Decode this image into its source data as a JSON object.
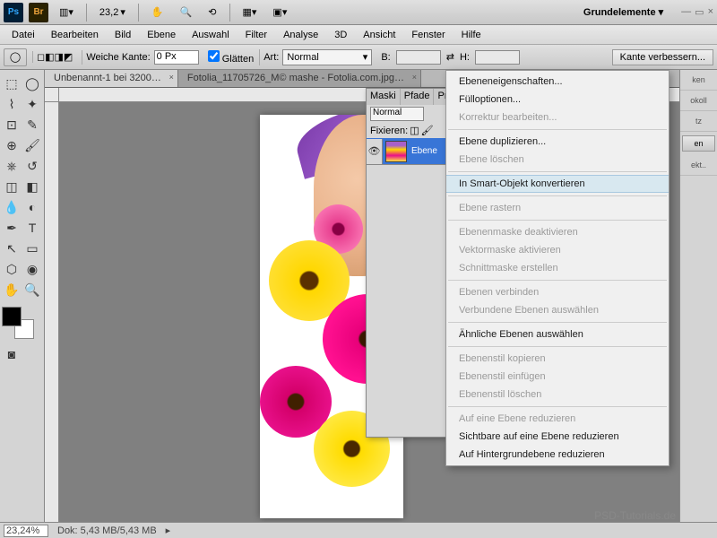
{
  "topbar": {
    "zoom_value": "23,2",
    "workspace": "Grundelemente"
  },
  "menu": [
    "Datei",
    "Bearbeiten",
    "Bild",
    "Ebene",
    "Auswahl",
    "Filter",
    "Analyse",
    "3D",
    "Ansicht",
    "Fenster",
    "Hilfe"
  ],
  "options": {
    "weiche_kante_label": "Weiche Kante:",
    "weiche_kante_value": "0 Px",
    "glaetten_label": "Glätten",
    "art_label": "Art:",
    "art_value": "Normal",
    "b_label": "B:",
    "h_label": "H:",
    "refine_btn": "Kante verbessern..."
  },
  "tabs": [
    {
      "label": "Unbenannt-1 bei 3200…",
      "active": true
    },
    {
      "label": "Fotolia_11705726_M© mashe - Fotolia.com.jpg…",
      "active": false
    }
  ],
  "layers_panel": {
    "tabs": [
      "Maski",
      "Pfade",
      "Pro"
    ],
    "blend_mode": "Normal",
    "fix_label": "Fixieren:",
    "layer_name": "Ebene"
  },
  "ctx_menu": [
    {
      "label": "Ebeneneigenschaften...",
      "en": true
    },
    {
      "label": "Fülloptionen...",
      "en": true
    },
    {
      "label": "Korrektur bearbeiten...",
      "en": false
    },
    {
      "sep": true
    },
    {
      "label": "Ebene duplizieren...",
      "en": true
    },
    {
      "label": "Ebene löschen",
      "en": false
    },
    {
      "sep": true
    },
    {
      "label": "In Smart-Objekt konvertieren",
      "en": true,
      "hover": true
    },
    {
      "sep": true
    },
    {
      "label": "Ebene rastern",
      "en": false
    },
    {
      "sep": true
    },
    {
      "label": "Ebenenmaske deaktivieren",
      "en": false
    },
    {
      "label": "Vektormaske aktivieren",
      "en": false
    },
    {
      "label": "Schnittmaske erstellen",
      "en": false
    },
    {
      "sep": true
    },
    {
      "label": "Ebenen verbinden",
      "en": false
    },
    {
      "label": "Verbundene Ebenen auswählen",
      "en": false
    },
    {
      "sep": true
    },
    {
      "label": "Ähnliche Ebenen auswählen",
      "en": true
    },
    {
      "sep": true
    },
    {
      "label": "Ebenenstil kopieren",
      "en": false
    },
    {
      "label": "Ebenenstil einfügen",
      "en": false
    },
    {
      "label": "Ebenenstil löschen",
      "en": false
    },
    {
      "sep": true
    },
    {
      "label": "Auf eine Ebene reduzieren",
      "en": false
    },
    {
      "label": "Sichtbare auf eine Ebene reduzieren",
      "en": true
    },
    {
      "label": "Auf Hintergrundebene reduzieren",
      "en": true
    }
  ],
  "right_panels": [
    "ken",
    "okoll",
    "tz",
    "en",
    "ekt.."
  ],
  "status": {
    "zoom": "23,24%",
    "dok": "Dok: 5,43 MB/5,43 MB"
  },
  "watermark": "PSD-Tutorials.de"
}
